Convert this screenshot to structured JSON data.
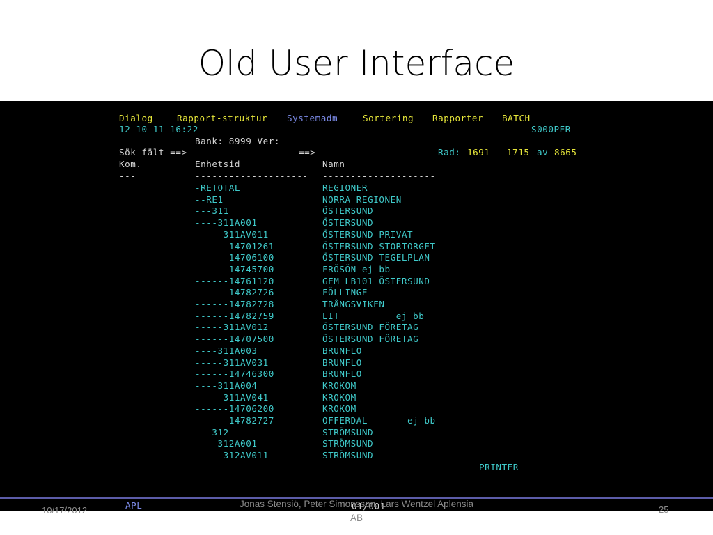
{
  "slide": {
    "title": "Old User Interface",
    "footer_date": "10/17/2012",
    "footer_authors": "Jonas Stensiö, Peter Simonsson, Lars Wentzel  Aplensia AB",
    "page_number": "25"
  },
  "terminal": {
    "menu": [
      "Dialog",
      "Rapport-struktur",
      "Systemadm",
      "Sortering",
      "Rapporter",
      "BATCH"
    ],
    "datetime": "12-10-11 16:22",
    "separator": "-----------------------------------------------------",
    "user": "S000PER",
    "bank_line": "Bank: 8999 Ver:",
    "search_label": "Sök fält ==>",
    "search_label2": "==>",
    "rad_label": "Rad:",
    "rad_range": "1691 - 1715",
    "rad_of": "av",
    "rad_total": "8665",
    "col_headers": [
      "Kom.",
      "Enhetsid",
      "Namn"
    ],
    "col_dashes": [
      "---",
      "--------------------",
      "--------------------"
    ],
    "rows": [
      {
        "id": "-RETOTAL",
        "name": "REGIONER"
      },
      {
        "id": "--RE1",
        "name": "NORRA REGIONEN"
      },
      {
        "id": "---311",
        "name": "ÖSTERSUND"
      },
      {
        "id": "----311A001",
        "name": "ÖSTERSUND"
      },
      {
        "id": "-----311AV011",
        "name": "ÖSTERSUND PRIVAT"
      },
      {
        "id": "------14701261",
        "name": "ÖSTERSUND STORTORGET"
      },
      {
        "id": "------14706100",
        "name": "ÖSTERSUND TEGELPLAN"
      },
      {
        "id": "------14745700",
        "name": "FRÖSÖN ej bb"
      },
      {
        "id": "------14761120",
        "name": "GEM LB101 ÖSTERSUND"
      },
      {
        "id": "------14782726",
        "name": "FÖLLINGE"
      },
      {
        "id": "------14782728",
        "name": "TRÅNGSVIKEN"
      },
      {
        "id": "------14782759",
        "name": "LIT          ej bb"
      },
      {
        "id": "-----311AV012",
        "name": "ÖSTERSUND FÖRETAG"
      },
      {
        "id": "------14707500",
        "name": "ÖSTERSUND FÖRETAG"
      },
      {
        "id": "----311A003",
        "name": "BRUNFLO"
      },
      {
        "id": "-----311AV031",
        "name": "BRUNFLO"
      },
      {
        "id": "------14746300",
        "name": "BRUNFLO"
      },
      {
        "id": "----311A004",
        "name": "KROKOM"
      },
      {
        "id": "-----311AV041",
        "name": "KROKOM"
      },
      {
        "id": "------14706200",
        "name": "KROKOM"
      },
      {
        "id": "------14782727",
        "name": "OFFERDAL       ej bb"
      },
      {
        "id": "---312",
        "name": "STRÖMSUND"
      },
      {
        "id": "----312A001",
        "name": "STRÖMSUND"
      },
      {
        "id": "-----312AV011",
        "name": "STRÖMSUND"
      }
    ],
    "printer": "PRINTER",
    "status_left": "APL",
    "status_page": "01/001"
  }
}
